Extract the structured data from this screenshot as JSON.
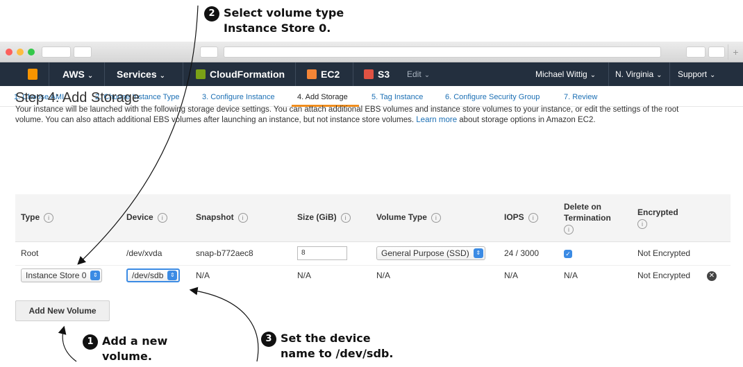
{
  "callouts": {
    "c1": {
      "num": "1",
      "line1": "Add a new",
      "line2": "volume."
    },
    "c2": {
      "num": "2",
      "line1": "Select volume type",
      "line2": "Instance Store 0."
    },
    "c3": {
      "num": "3",
      "line1": "Set the device",
      "line2": "name to /dev/sdb."
    }
  },
  "browser": {
    "new_tab_glyph": "+"
  },
  "awsnav": {
    "brand": "AWS",
    "services": "Services",
    "cloudformation": "CloudFormation",
    "ec2": "EC2",
    "s3": "S3",
    "edit": "Edit",
    "user": "Michael Wittig",
    "region": "N. Virginia",
    "support": "Support",
    "caret": "⌄"
  },
  "wizard": {
    "tabs": [
      {
        "label": "1. Choose AMI"
      },
      {
        "label": "2. Choose Instance Type"
      },
      {
        "label": "3. Configure Instance"
      },
      {
        "label": "4. Add Storage"
      },
      {
        "label": "5. Tag Instance"
      },
      {
        "label": "6. Configure Security Group"
      },
      {
        "label": "7. Review"
      }
    ],
    "active_index": 3
  },
  "page": {
    "title": "Step 4: Add Storage",
    "desc_before_link": "Your instance will be launched with the following storage device settings. You can attach additional EBS volumes and instance store volumes to your instance, or edit the settings of the root volume. You can also attach additional EBS volumes after launching an instance, but not instance store volumes. ",
    "learn_more": "Learn more",
    "desc_after_link": " about storage options in Amazon EC2."
  },
  "table": {
    "headers": {
      "type": "Type",
      "device": "Device",
      "snapshot": "Snapshot",
      "size": "Size (GiB)",
      "volume_type": "Volume Type",
      "iops": "IOPS",
      "delete_l1": "Delete on",
      "delete_l2": "Termination",
      "encrypted": "Encrypted",
      "info": "i"
    },
    "row1": {
      "type": "Root",
      "device": "/dev/xvda",
      "snapshot": "snap-b772aec8",
      "size": "8",
      "volume_type": "General Purpose (SSD)",
      "iops": "24 / 3000",
      "delete_checked": "✓",
      "encrypted": "Not Encrypted"
    },
    "row2": {
      "type": "Instance Store 0",
      "device": "/dev/sdb",
      "snapshot": "N/A",
      "size": "N/A",
      "volume_type": "N/A",
      "iops": "N/A",
      "delete": "N/A",
      "encrypted": "Not Encrypted",
      "remove_glyph": "✕"
    },
    "select_arrow": "⇕"
  },
  "add_button": "Add New Volume",
  "colors": {
    "nav_bg": "#232f3e",
    "link": "#1b6fb4",
    "active_tab": "#f08d1d",
    "select_accent": "#3b8be4"
  }
}
